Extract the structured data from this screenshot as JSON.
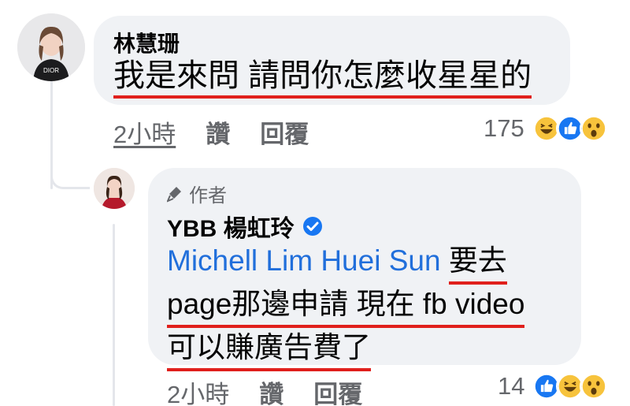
{
  "comment1": {
    "author": "林慧珊",
    "text": "我是來問 請問你怎麼收星星的",
    "time": "2小時",
    "like_label": "讚",
    "reply_label": "回覆",
    "reaction_count": "175",
    "reactions": [
      "haha-icon",
      "like-icon",
      "wow-icon"
    ],
    "avatar_shirt_text": "DIOR"
  },
  "comment2": {
    "badge_label": "作者",
    "author": "YBB 楊虹玲",
    "mention": "Michell Lim Huei Sun",
    "text_line1_tail": "要去",
    "text_line2": "page那邊申請 現在 fb video",
    "text_line3": "可以賺廣告費了",
    "time": "2小時",
    "like_label": "讚",
    "reply_label": "回覆",
    "reaction_count": "14",
    "reactions": [
      "like-icon",
      "haha-icon",
      "wow-icon"
    ]
  },
  "colors": {
    "bubble": "#f0f2f5",
    "mention": "#216fdb",
    "underline": "#e0201c",
    "meta": "#65676b",
    "verified": "#1877f2"
  }
}
